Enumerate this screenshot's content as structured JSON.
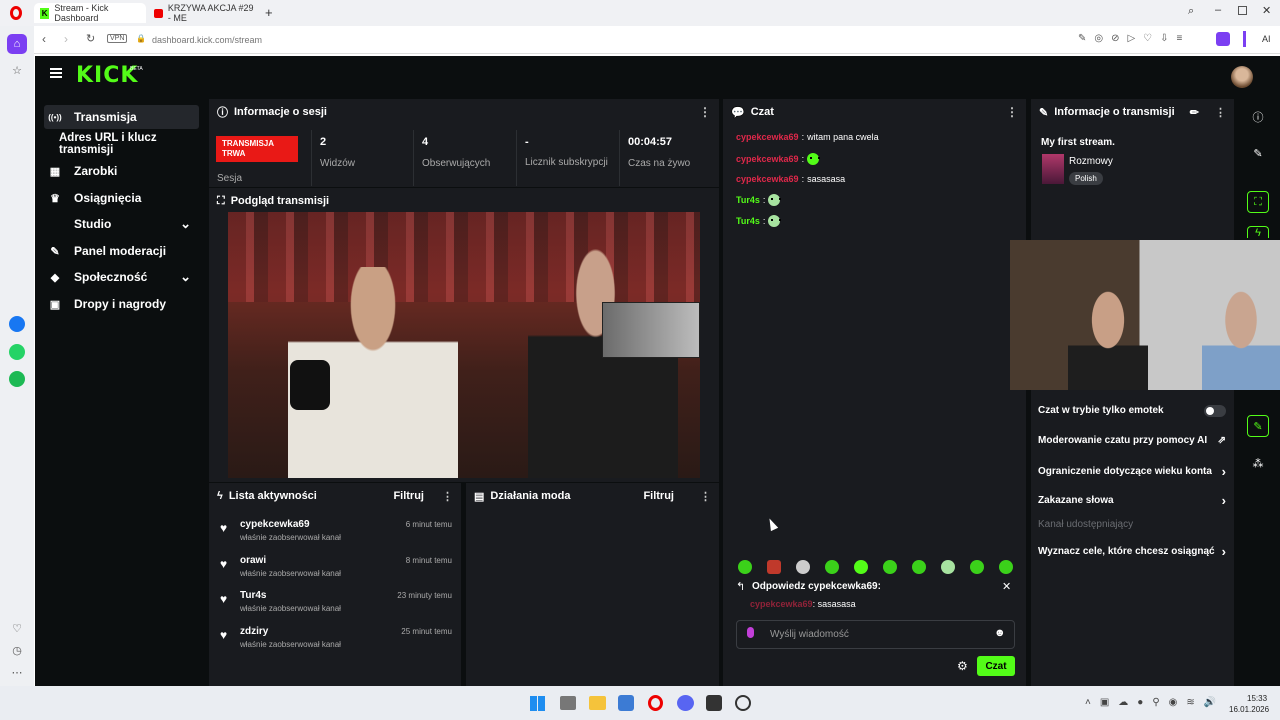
{
  "browser": {
    "tabs": [
      {
        "label": "Stream - Kick Dashboard",
        "active": true
      },
      {
        "label": "KRZYWA AKCJA #29 - ME",
        "active": false
      }
    ],
    "vpn": "VPN",
    "url": "dashboard.kick.com/stream",
    "ai_label": "AI"
  },
  "nav": {
    "logo": "KICK",
    "beta": "BETA",
    "items": [
      {
        "label": "Transmisja",
        "icon": "broadcast-icon",
        "glyph": "((•))"
      },
      {
        "label": "Adres URL i klucz transmisji",
        "icon": "",
        "glyph": ""
      },
      {
        "label": "Zarobki",
        "icon": "wallet-icon",
        "glyph": "▦"
      },
      {
        "label": "Osiągnięcia",
        "icon": "trophy-icon",
        "glyph": "🏆"
      },
      {
        "label": "Studio",
        "icon": "",
        "glyph": "",
        "chevron": "⌄"
      },
      {
        "label": "Panel moderacji",
        "icon": "wrench-icon",
        "glyph": "🔧"
      },
      {
        "label": "Społeczność",
        "icon": "community-icon",
        "glyph": "◆",
        "chevron": "⌄"
      },
      {
        "label": "Dropy i nagrody",
        "icon": "gift-icon",
        "glyph": "▣"
      }
    ]
  },
  "session": {
    "title": "Informacje o sesji",
    "live_badge": "TRANSMISJA TRWA",
    "live_label": "Sesja",
    "stats": [
      {
        "value": "2",
        "label": "Widzów"
      },
      {
        "value": "4",
        "label": "Obserwujących"
      },
      {
        "value": "-",
        "label": "Licznik subskrypcji"
      },
      {
        "value": "00:04:57",
        "label": "Czas na żywo"
      }
    ]
  },
  "preview": {
    "title": "Podgląd transmisji"
  },
  "activity": {
    "title": "Lista aktywności",
    "filter": "Filtruj",
    "items": [
      {
        "name": "cypekcewka69",
        "desc": "właśnie zaobserwował kanał",
        "time": "6 minut temu"
      },
      {
        "name": "orawi",
        "desc": "właśnie zaobserwował kanał",
        "time": "8 minut temu"
      },
      {
        "name": "Tur4s",
        "desc": "właśnie zaobserwował kanał",
        "time": "23 minuty temu"
      },
      {
        "name": "zdziry",
        "desc": "właśnie zaobserwował kanał",
        "time": "25 minut temu"
      }
    ]
  },
  "mod": {
    "title": "Działania moda",
    "filter": "Filtruj"
  },
  "chat": {
    "title": "Czat",
    "messages": [
      {
        "user": "cypekcewka69",
        "sep": ":",
        "text": "witam pana cwela",
        "emote": false
      },
      {
        "user": "cypekcewka69",
        "sep": ":",
        "text": "",
        "emote": true
      },
      {
        "user": "cypekcewka69",
        "sep": ":",
        "text": "sasasasa",
        "emote": false
      },
      {
        "user": "Tur4s",
        "sep": ":",
        "text": "",
        "emote": true
      },
      {
        "user": "Tur4s",
        "sep": ":",
        "text": "",
        "emote": true
      }
    ],
    "reply_title": "Odpowiedz cypekcewka69:",
    "reply_user": "cypekcewka69",
    "reply_text": "sasasasa",
    "input_placeholder": "Wyślij wiadomość",
    "send_button": "Czat"
  },
  "stream_info": {
    "title": "Informacje o transmisji",
    "stream_title": "My first stream.",
    "category": "Rozmowy",
    "language": "Polish",
    "options": [
      {
        "label": "Czat w trybie tylko emotek",
        "control": "toggle"
      },
      {
        "label": "Moderowanie czatu przy pomocy AI",
        "control": "external"
      },
      {
        "label": "Ograniczenie dotyczące wieku konta",
        "control": "chevron"
      },
      {
        "label": "Zakazane słowa",
        "control": "chevron"
      },
      {
        "label": "Kanał udostępniający",
        "control": "disabled"
      },
      {
        "label": "Wyznacz cele, które chcesz osiągnąć",
        "control": "chevron"
      }
    ]
  },
  "taskbar": {
    "time": "15:33",
    "date": "16.01.2026"
  },
  "colors": {
    "accent": "#53fc18",
    "live": "#e91916",
    "chat_user": "#e0284a",
    "panel": "#191b1f",
    "bg": "#0b0e0f"
  }
}
